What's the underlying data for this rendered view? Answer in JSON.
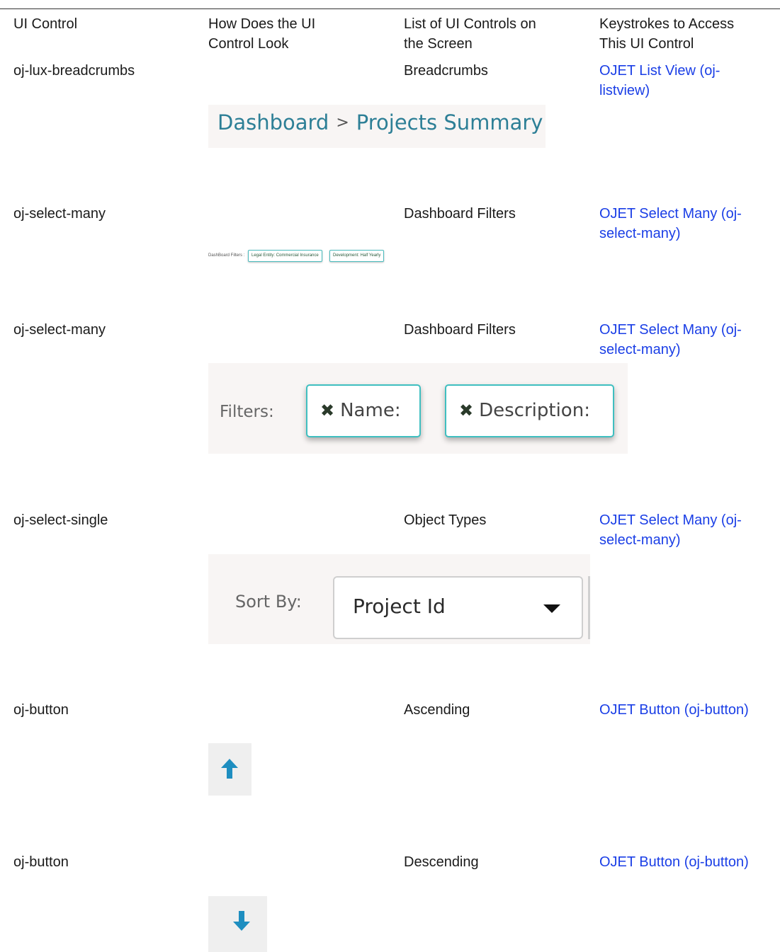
{
  "header": {
    "col1": "UI Control",
    "col2_line1": "How Does the UI",
    "col2_line2": "Control Look",
    "col3_line1": "List of UI Controls on",
    "col3_line2": "the Screen",
    "col4_line1": "Keystrokes to Access",
    "col4_line2": "This UI Control"
  },
  "rows": [
    {
      "control": "oj-lux-breadcrumbs",
      "list_item": "Breadcrumbs",
      "link_line1": "OJET List View (oj-",
      "link_line2": "listview)",
      "image": {
        "crumb1": "Dashboard",
        "separator": ">",
        "crumb2": "Projects Summary"
      }
    },
    {
      "control": "oj-select-many",
      "list_item": "Dashboard Filters",
      "link_line1": "OJET Select Many (oj-",
      "link_line2": "select-many)",
      "image": {
        "label": "DashBoard Filters :",
        "chip1": "Legal Entity: Commercial Insurance",
        "chip2": "Development: Half Yearly"
      }
    },
    {
      "control": "oj-select-many",
      "list_item": "Dashboard Filters",
      "link_line1": "OJET Select Many (oj-",
      "link_line2": "select-many)",
      "image": {
        "label": "Filters:",
        "chip_icon": "✖",
        "chip1": "Name:",
        "chip2": "Description:"
      }
    },
    {
      "control": "oj-select-single",
      "list_item": "Object Types",
      "link_line1": "OJET Select Many (oj-",
      "link_line2": "select-many)",
      "image": {
        "label": "Sort By:",
        "value": "Project Id",
        "caret_icon": "caret-down-icon"
      }
    },
    {
      "control": "oj-button",
      "list_item": "Ascending",
      "link_line1": "OJET Button (oj-button)",
      "image": {
        "icon": "arrow-up-icon",
        "color": "#1e8ec0"
      }
    },
    {
      "control": "oj-button",
      "list_item": "Descending",
      "link_line1": "OJET Button (oj-button)",
      "image": {
        "icon": "arrow-down-icon",
        "color": "#1e8ec0"
      }
    }
  ]
}
